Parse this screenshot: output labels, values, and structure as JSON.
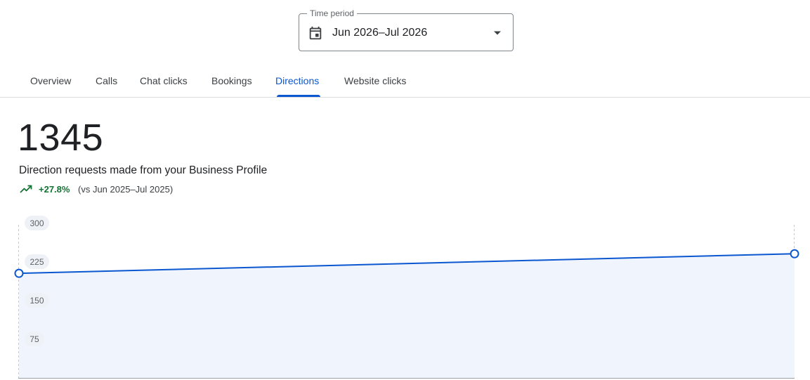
{
  "time_period": {
    "label": "Time period",
    "value": "Jun 2026–Jul 2026",
    "icon": "calendar-icon"
  },
  "tabs": [
    {
      "label": "Overview",
      "active": false
    },
    {
      "label": "Calls",
      "active": false
    },
    {
      "label": "Chat clicks",
      "active": false
    },
    {
      "label": "Bookings",
      "active": false
    },
    {
      "label": "Directions",
      "active": true
    },
    {
      "label": "Website clicks",
      "active": false
    }
  ],
  "metric": {
    "value": "1345",
    "description": "Direction requests made from your Business Profile",
    "change": "+27.8%",
    "comparison": "(vs Jun 2025–Jul 2025)",
    "trend_icon": "trending-up-icon"
  },
  "colors": {
    "accent": "#0b57d0",
    "positive": "#137333",
    "area_fill": "#f0f4fc"
  },
  "chart_data": {
    "type": "area",
    "y_ticks": [
      "300",
      "225",
      "150",
      "75"
    ],
    "ylim": [
      0,
      300
    ],
    "grid": false,
    "series": [
      {
        "values": [
          203,
          241
        ]
      }
    ]
  }
}
